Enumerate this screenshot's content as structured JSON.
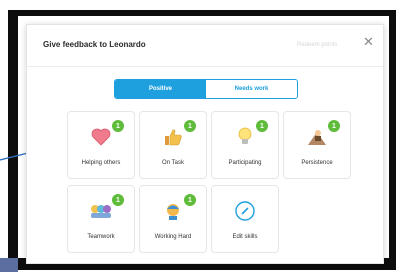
{
  "modal": {
    "title": "Give feedback to Leonardo",
    "redeem_label": "Redeem points",
    "close_glyph": "✕"
  },
  "tabs": [
    {
      "label": "Positive",
      "active": true
    },
    {
      "label": "Needs work",
      "active": false
    }
  ],
  "skills": [
    {
      "label": "Helping others",
      "badge": "1",
      "icon": "heart-icon"
    },
    {
      "label": "On Task",
      "badge": "1",
      "icon": "thumbs-up-icon"
    },
    {
      "label": "Participating",
      "badge": "1",
      "icon": "lightbulb-icon"
    },
    {
      "label": "Persistence",
      "badge": "1",
      "icon": "climber-icon"
    },
    {
      "label": "Teamwork",
      "badge": "1",
      "icon": "team-icon"
    },
    {
      "label": "Working Hard",
      "badge": "1",
      "icon": "hard-worker-icon"
    },
    {
      "label": "Edit skills",
      "icon": "pencil-icon"
    }
  ],
  "colors": {
    "accent": "#1ea0de",
    "badge": "#5fbb3a"
  }
}
